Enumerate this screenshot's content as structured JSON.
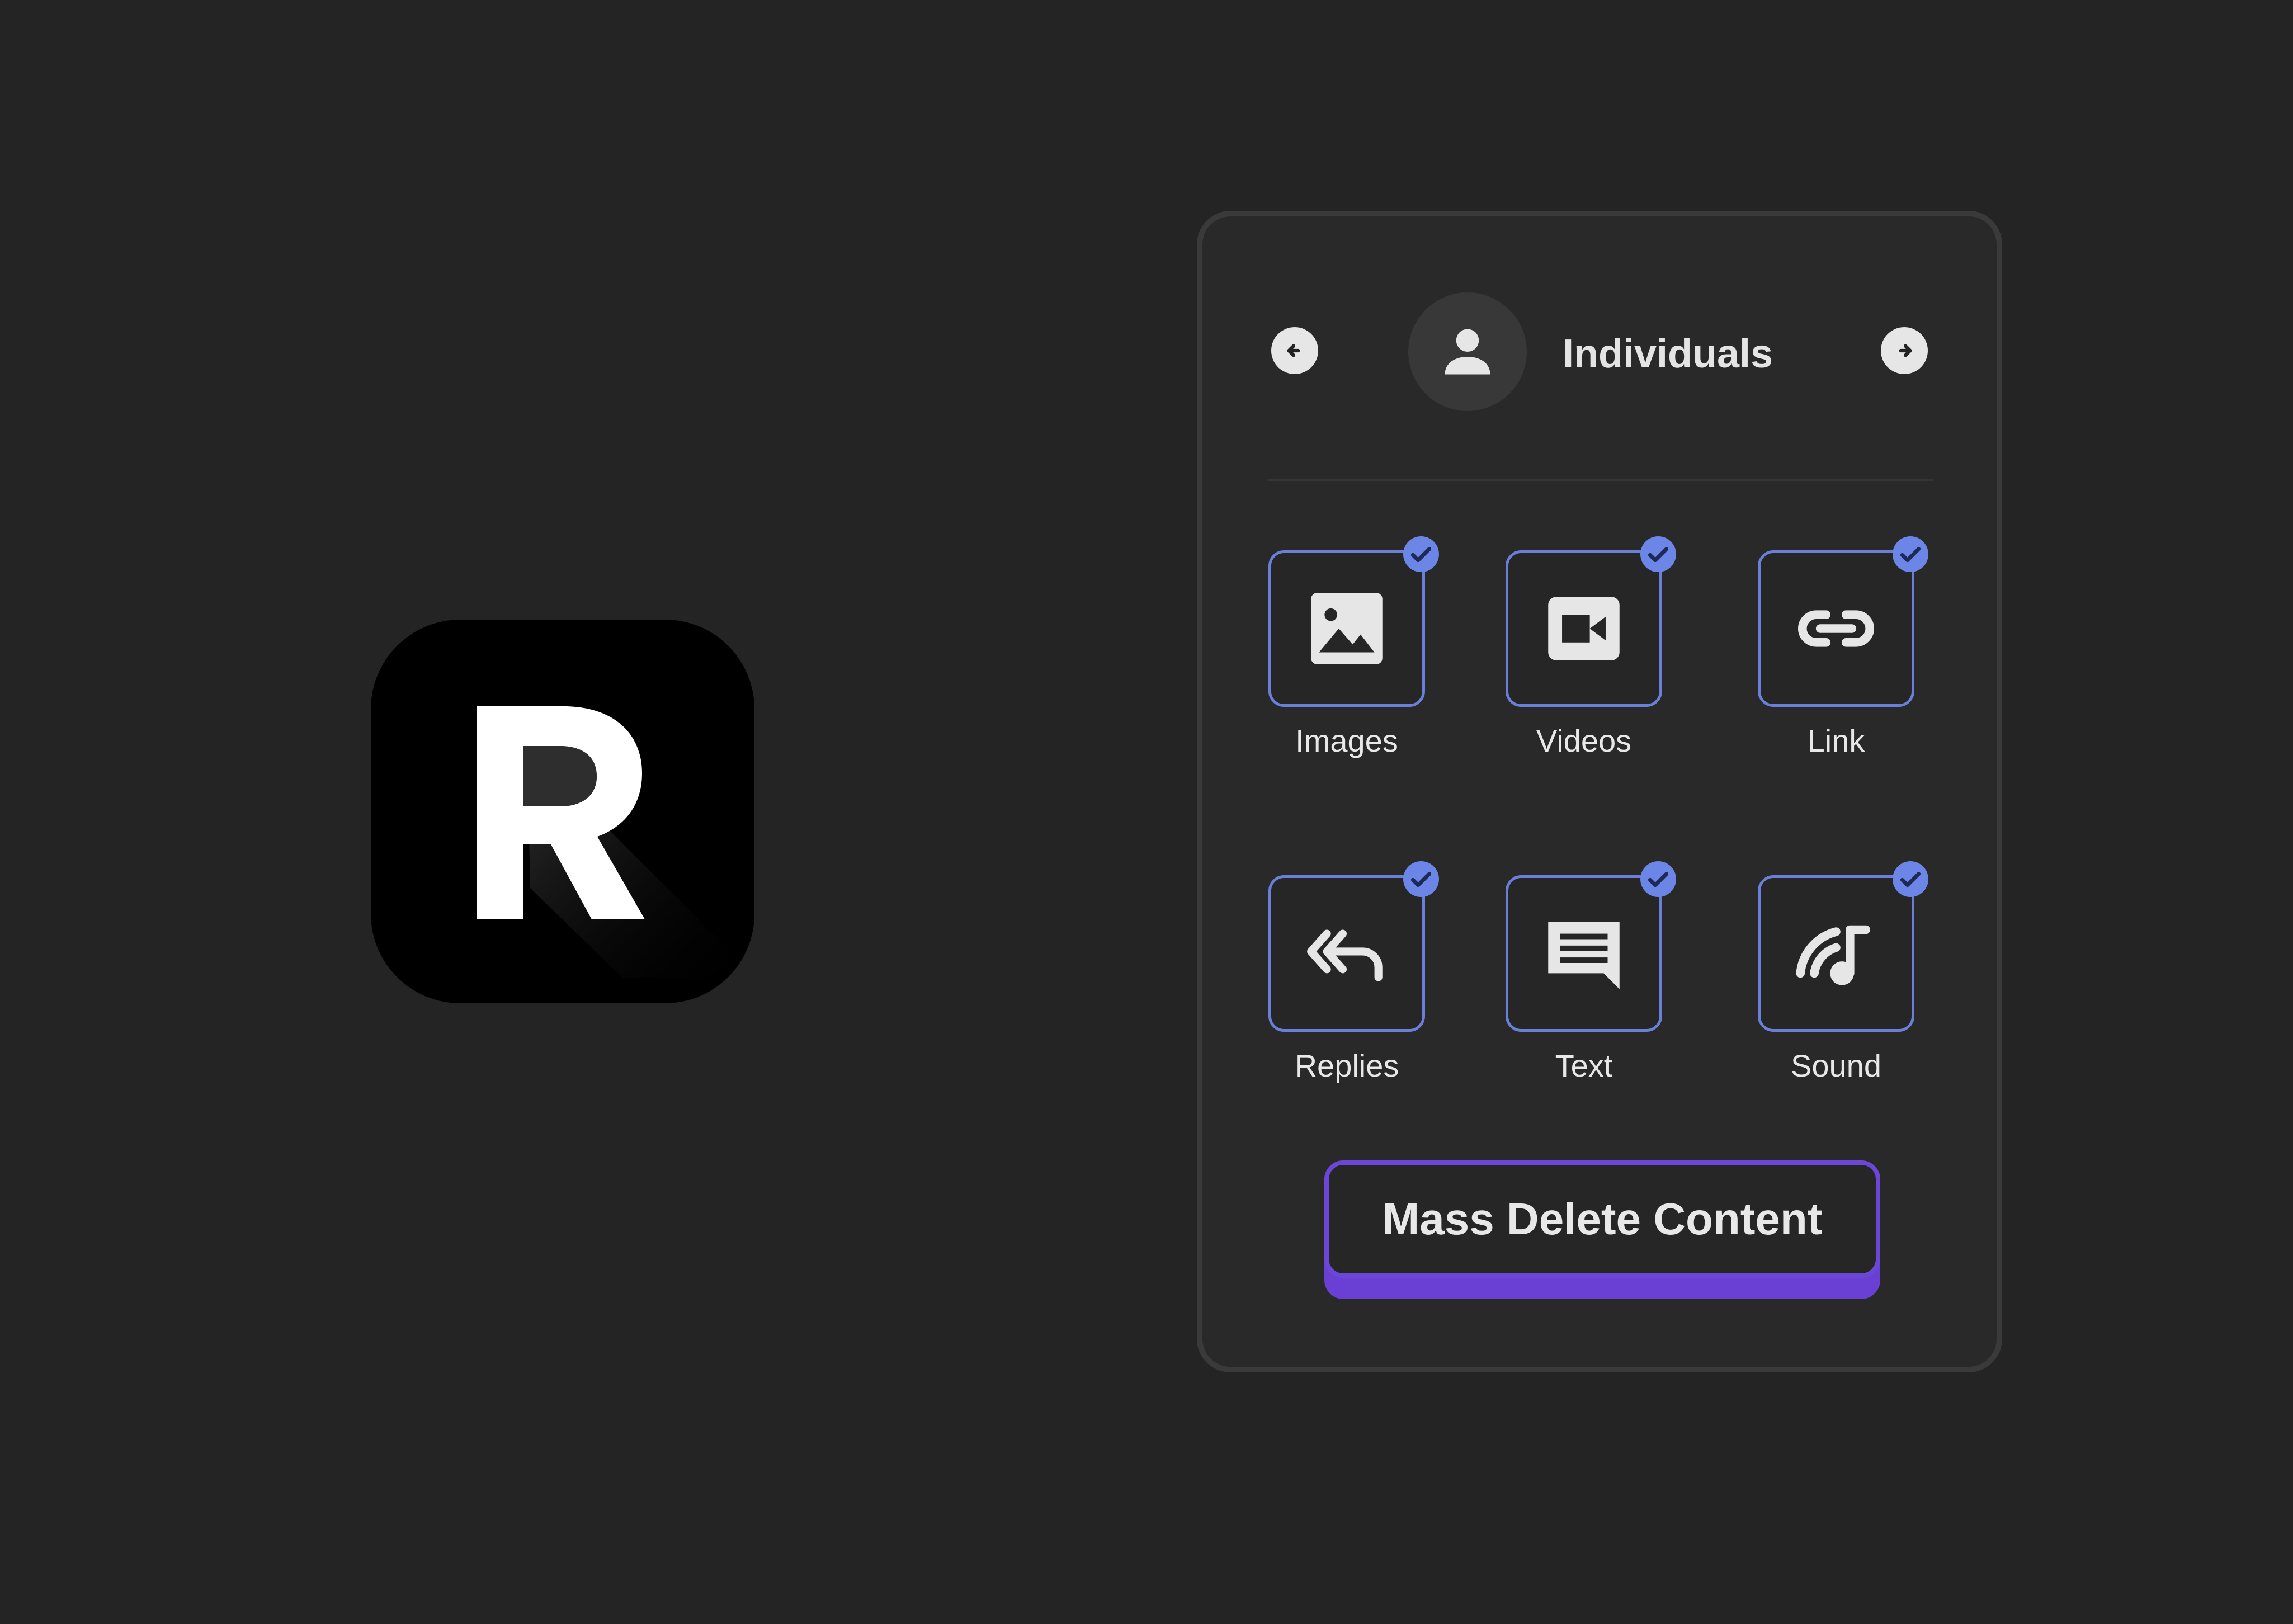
{
  "app_icon": {
    "letter": "R"
  },
  "header": {
    "title": "Individuals"
  },
  "options": [
    {
      "label": "Images",
      "icon": "image-icon",
      "checked": true
    },
    {
      "label": "Videos",
      "icon": "video-icon",
      "checked": true
    },
    {
      "label": "Link",
      "icon": "link-icon",
      "checked": true
    },
    {
      "label": "Replies",
      "icon": "reply-all-icon",
      "checked": true
    },
    {
      "label": "Text",
      "icon": "message-text-icon",
      "checked": true
    },
    {
      "label": "Sound",
      "icon": "sound-icon",
      "checked": true
    }
  ],
  "action": {
    "label": "Mass Delete Content"
  },
  "colors": {
    "background": "#242424",
    "panel": "#292929",
    "tile_border": "#6a7fd8",
    "check": "#6b86e6",
    "button_accent": "#6b47d8"
  }
}
